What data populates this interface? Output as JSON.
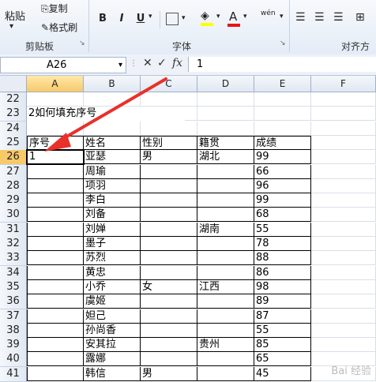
{
  "ribbon": {
    "paste": "粘贴",
    "copy": "复制",
    "format_painter": "格式刷",
    "clipboard": "剪贴板",
    "font_group": "字体",
    "align_group": "对齐方",
    "bold": "B",
    "italic": "I",
    "underline": "U",
    "font_color": "A",
    "phonetic": "wén"
  },
  "formula_bar": {
    "name_box": "A26",
    "fx": "fx",
    "content": "1"
  },
  "columns": [
    "A",
    "B",
    "C",
    "D",
    "E",
    "F"
  ],
  "rows": [
    "22",
    "23",
    "24",
    "25",
    "26",
    "27",
    "28",
    "29",
    "30",
    "31",
    "32",
    "33",
    "34",
    "35",
    "36",
    "37",
    "38",
    "39",
    "40",
    "41"
  ],
  "title_cell": "2如何填充序号",
  "headers": {
    "seq": "序号",
    "name": "姓名",
    "gender": "性别",
    "origin": "籍贯",
    "score": "成绩"
  },
  "records": [
    {
      "seq": "1",
      "name": "亚瑟",
      "gender": "男",
      "origin": "湖北",
      "score": "99"
    },
    {
      "seq": "",
      "name": "周瑜",
      "gender": "",
      "origin": "",
      "score": "66"
    },
    {
      "seq": "",
      "name": "项羽",
      "gender": "",
      "origin": "",
      "score": "96"
    },
    {
      "seq": "",
      "name": "李白",
      "gender": "",
      "origin": "",
      "score": "99"
    },
    {
      "seq": "",
      "name": "刘备",
      "gender": "",
      "origin": "",
      "score": "68"
    },
    {
      "seq": "",
      "name": "刘婵",
      "gender": "",
      "origin": "湖南",
      "score": "55"
    },
    {
      "seq": "",
      "name": "墨子",
      "gender": "",
      "origin": "",
      "score": "78"
    },
    {
      "seq": "",
      "name": "苏烈",
      "gender": "",
      "origin": "",
      "score": "88"
    },
    {
      "seq": "",
      "name": "黄忠",
      "gender": "",
      "origin": "",
      "score": "86"
    },
    {
      "seq": "",
      "name": "小乔",
      "gender": "女",
      "origin": "江西",
      "score": "98"
    },
    {
      "seq": "",
      "name": "虞姬",
      "gender": "",
      "origin": "",
      "score": "89"
    },
    {
      "seq": "",
      "name": "妲己",
      "gender": "",
      "origin": "",
      "score": "87"
    },
    {
      "seq": "",
      "name": "孙尚香",
      "gender": "",
      "origin": "",
      "score": "55"
    },
    {
      "seq": "",
      "name": "安其拉",
      "gender": "",
      "origin": "贵州",
      "score": "85"
    },
    {
      "seq": "",
      "name": "露娜",
      "gender": "",
      "origin": "",
      "score": "65"
    },
    {
      "seq": "",
      "name": "韩信",
      "gender": "男",
      "origin": "",
      "score": "45"
    }
  ],
  "colors": {
    "arrow": "#e8312a",
    "selected_header": "#f7c96a"
  }
}
